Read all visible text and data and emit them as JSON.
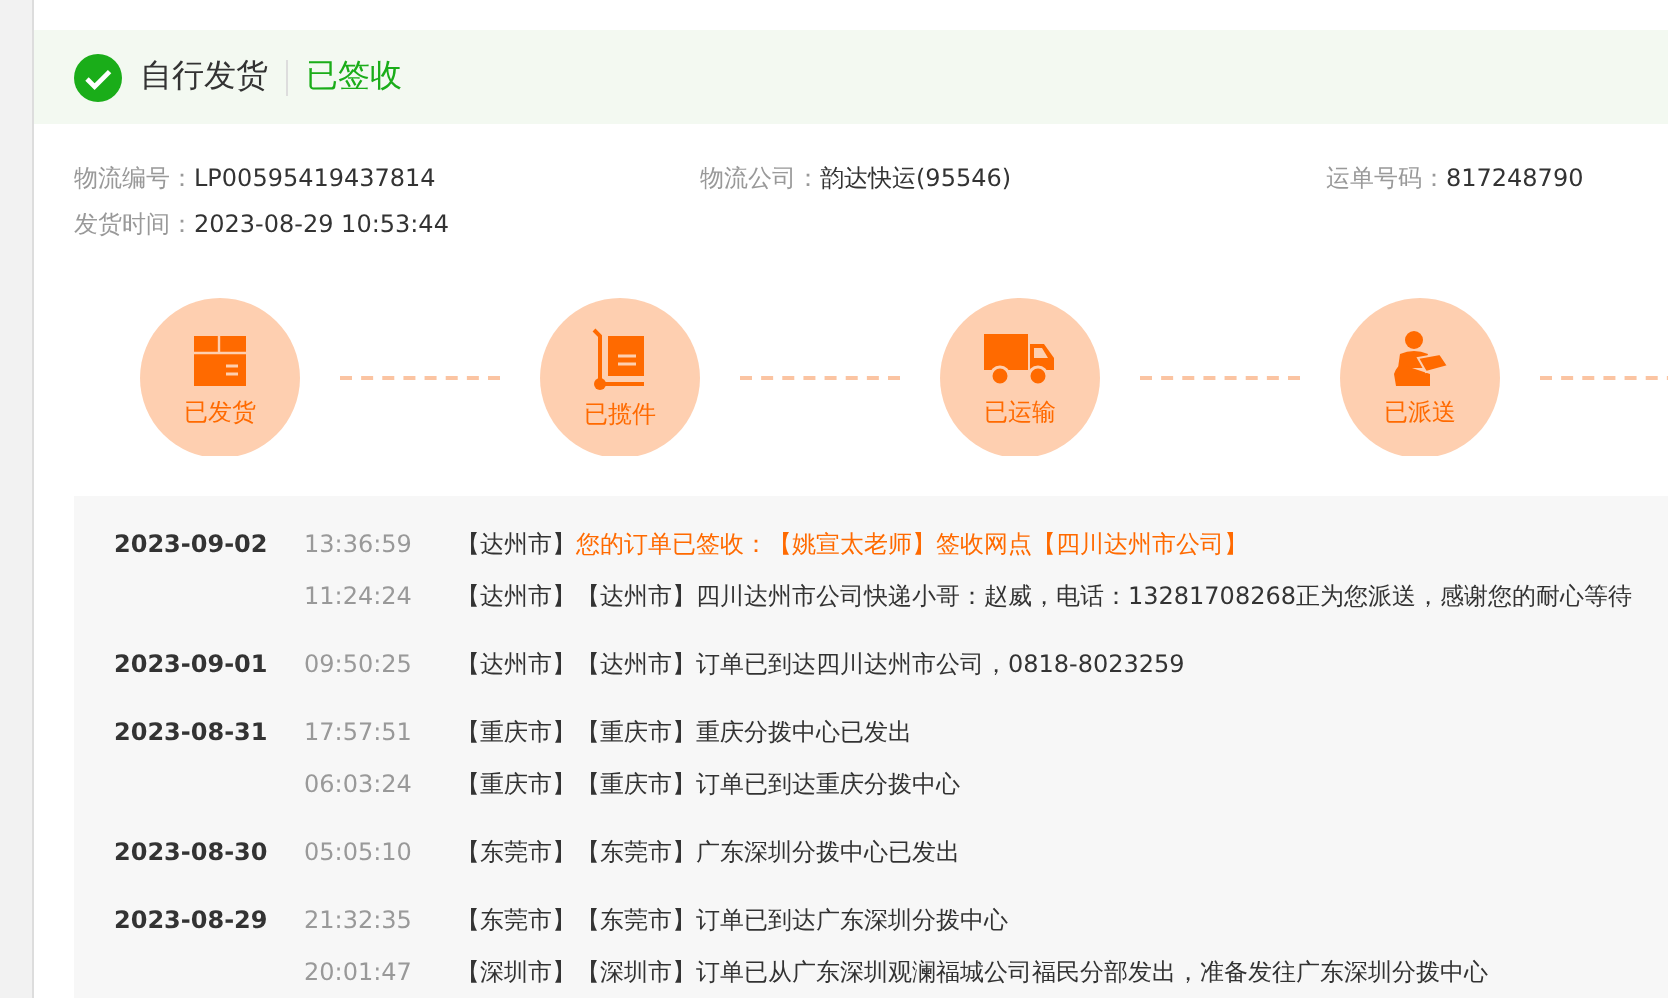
{
  "status": {
    "method": "自行发货",
    "state": "已签收"
  },
  "info": [
    {
      "label": "物流编号：",
      "value": "LP00595419437814"
    },
    {
      "label": "物流公司：",
      "value": "韵达快运(95546)"
    },
    {
      "label": "运单号码：",
      "value": "817248790"
    },
    {
      "label": "发货时间：",
      "value": "2023-08-29 10:53:44"
    }
  ],
  "steps": [
    {
      "kind": "box",
      "label": "已发货"
    },
    {
      "kind": "cart",
      "label": "已揽件"
    },
    {
      "kind": "truck",
      "label": "已运输"
    },
    {
      "kind": "courier",
      "label": "已派送"
    }
  ],
  "timeline": [
    {
      "date": "2023-09-02",
      "events": [
        {
          "time": "13:36:59",
          "place": "【达州市】",
          "text": "您的订单已签收：【姚宣太老师】签收网点【四川达州市公司】",
          "latest": true
        },
        {
          "time": "11:24:24",
          "place": "【达州市】【达州市】",
          "text": "四川达州市公司快递小哥：赵威，电话：13281708268正为您派送，感谢您的耐心等待",
          "latest": false
        }
      ]
    },
    {
      "date": "2023-09-01",
      "events": [
        {
          "time": "09:50:25",
          "place": "【达州市】【达州市】",
          "text": "订单已到达四川达州市公司，0818-8023259",
          "latest": false
        }
      ]
    },
    {
      "date": "2023-08-31",
      "events": [
        {
          "time": "17:57:51",
          "place": "【重庆市】【重庆市】",
          "text": "重庆分拨中心已发出",
          "latest": false
        },
        {
          "time": "06:03:24",
          "place": "【重庆市】【重庆市】",
          "text": "订单已到达重庆分拨中心",
          "latest": false
        }
      ]
    },
    {
      "date": "2023-08-30",
      "events": [
        {
          "time": "05:05:10",
          "place": "【东莞市】【东莞市】",
          "text": "广东深圳分拨中心已发出",
          "latest": false
        }
      ]
    },
    {
      "date": "2023-08-29",
      "events": [
        {
          "time": "21:32:35",
          "place": "【东莞市】【东莞市】",
          "text": "订单已到达广东深圳分拨中心",
          "latest": false
        },
        {
          "time": "20:01:47",
          "place": "【深圳市】【深圳市】",
          "text": "订单已从广东深圳观澜福城公司福民分部发出，准备发往广东深圳分拨中心",
          "latest": false
        }
      ]
    }
  ]
}
